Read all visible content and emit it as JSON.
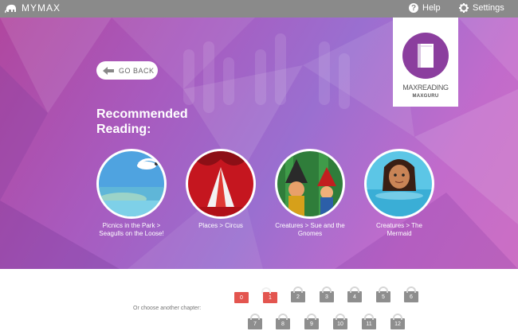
{
  "app": {
    "brand": "MYMAX"
  },
  "nav": {
    "help_label": "Help",
    "settings_label": "Settings"
  },
  "go_back": {
    "label": "GO BACK"
  },
  "heading": "Recommended Reading:",
  "recommended": [
    {
      "label": "Picnics in the Park > Seagulls on the Loose!",
      "icon": "seagull-picture"
    },
    {
      "label": "Places > Circus",
      "icon": "circus-tent-picture"
    },
    {
      "label": "Creatures > Sue and the Gnomes",
      "icon": "gnomes-picture"
    },
    {
      "label": "Creatures > The Mermaid",
      "icon": "mermaid-picture"
    }
  ],
  "max_panel": {
    "title": "MAXREADING",
    "subtitle": "MAXGURU",
    "icon": "book-icon"
  },
  "chapters": {
    "label": "Or choose another chapter:",
    "items": [
      {
        "label": "0",
        "locked": false
      },
      {
        "label": "1",
        "locked": false
      },
      {
        "label": "2",
        "locked": true
      },
      {
        "label": "3",
        "locked": true
      },
      {
        "label": "4",
        "locked": true
      },
      {
        "label": "5",
        "locked": true
      },
      {
        "label": "6",
        "locked": true
      },
      {
        "label": "7",
        "locked": true
      },
      {
        "label": "8",
        "locked": true
      },
      {
        "label": "9",
        "locked": true
      },
      {
        "label": "10",
        "locked": true
      },
      {
        "label": "11",
        "locked": true
      },
      {
        "label": "12",
        "locked": true
      }
    ]
  },
  "colors": {
    "topbar": "#8a8a8a",
    "accent_purple": "#8b3e9e",
    "unlocked": "#e3554f",
    "locked": "#8e8e8e"
  }
}
